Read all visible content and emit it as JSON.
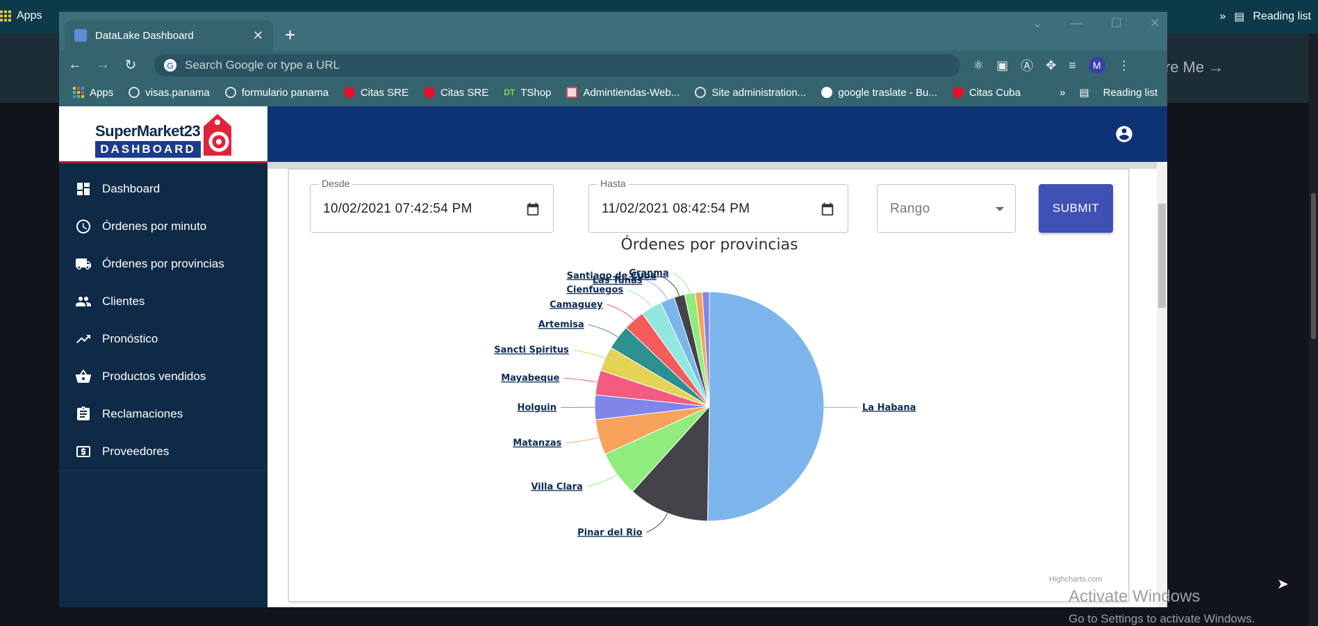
{
  "desktop": {
    "apps_label": "Apps",
    "reading_list_label": "Reading list",
    "overflow_label": "»",
    "hire_text": "ire Me →",
    "activate_title": "Activate Windows",
    "activate_sub": "Go to Settings to activate Windows."
  },
  "browser": {
    "tab_title": "DataLake Dashboard",
    "omnibox_placeholder": "Search Google or type a URL",
    "profile_initial": "M",
    "bookmarks": [
      {
        "label": "Apps",
        "icon": "apps-grid-icon"
      },
      {
        "label": "visas.panama",
        "icon": "globe-icon"
      },
      {
        "label": "formulario panama",
        "icon": "globe-icon"
      },
      {
        "label": "Citas SRE",
        "icon": "red-circle-icon"
      },
      {
        "label": "Citas SRE",
        "icon": "red-circle-icon"
      },
      {
        "label": "TShop",
        "icon": "dt-icon"
      },
      {
        "label": "Admintiendas-Web...",
        "icon": "admin-icon"
      },
      {
        "label": "Site administration...",
        "icon": "globe-icon"
      },
      {
        "label": "google traslate - Bu...",
        "icon": "google-icon"
      },
      {
        "label": "Citas Cuba",
        "icon": "red-circle-icon"
      }
    ],
    "bookmarks_overflow": "»",
    "reading_list": "Reading list"
  },
  "logo": {
    "line1": "SuperMarket23",
    "line2": "DASHBOARD"
  },
  "nav": [
    {
      "label": "Dashboard",
      "icon": "dashboard-icon"
    },
    {
      "label": "Órdenes por minuto",
      "icon": "clock-icon"
    },
    {
      "label": "Órdenes por provincias",
      "icon": "truck-icon"
    },
    {
      "label": "Clientes",
      "icon": "people-icon"
    },
    {
      "label": "Pronóstico",
      "icon": "trending-up-icon"
    },
    {
      "label": "Productos vendidos",
      "icon": "basket-icon"
    },
    {
      "label": "Reclamaciones",
      "icon": "clipboard-icon"
    },
    {
      "label": "Proveedores",
      "icon": "dollar-box-icon"
    }
  ],
  "filters": {
    "desde_label": "Desde",
    "desde_value": "10/02/2021 07:42:54 PM",
    "hasta_label": "Hasta",
    "hasta_value": "11/02/2021 08:42:54 PM",
    "rango_label": "Rango",
    "submit_label": "SUBMIT"
  },
  "chart_data": {
    "type": "pie",
    "title": "Órdenes por provincias",
    "credits": "Highcharts.com",
    "slices": [
      {
        "name": "La Habana",
        "value": 50.5,
        "color": "#7cb5ec"
      },
      {
        "name": "Pinar del Rio",
        "value": 11.5,
        "color": "#434348"
      },
      {
        "name": "Villa Clara",
        "value": 6.5,
        "color": "#90ed7d"
      },
      {
        "name": "Matanzas",
        "value": 5.0,
        "color": "#f7a35c"
      },
      {
        "name": "Holguin",
        "value": 3.5,
        "color": "#8085e9"
      },
      {
        "name": "Mayabeque",
        "value": 3.5,
        "color": "#f15c80"
      },
      {
        "name": "Sancti Spiritus",
        "value": 3.5,
        "color": "#e4d354"
      },
      {
        "name": "Artemisa",
        "value": 3.5,
        "color": "#2b908f"
      },
      {
        "name": "Camaguey",
        "value": 3.0,
        "color": "#f45b5b"
      },
      {
        "name": "Cienfuegos",
        "value": 3.0,
        "color": "#91e8e1"
      },
      {
        "name": "Las Tunas",
        "value": 2.0,
        "color": "#7cb5ec"
      },
      {
        "name": "Santiago de Cuba",
        "value": 1.5,
        "color": "#434348"
      },
      {
        "name": "Granma",
        "value": 1.5,
        "color": "#90ed7d"
      },
      {
        "name": "",
        "value": 1.0,
        "color": "#f7a35c"
      },
      {
        "name": "",
        "value": 1.0,
        "color": "#8085e9"
      }
    ]
  }
}
